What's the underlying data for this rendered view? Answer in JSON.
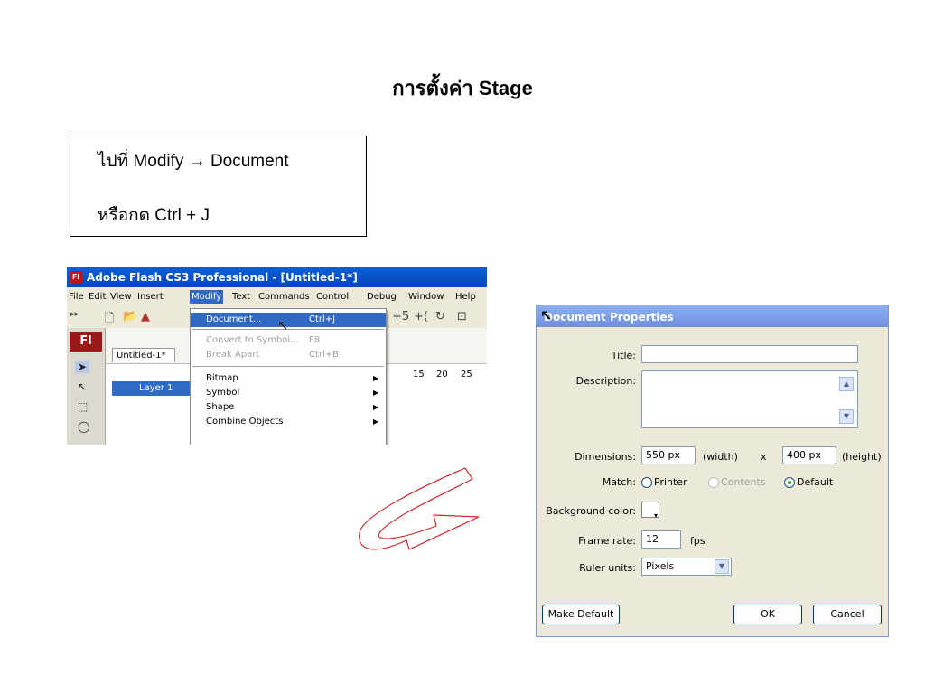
{
  "slide": {
    "title": "การตั้งค่า Stage",
    "instructions": {
      "line1": "ไปที่ Modify → Document",
      "line2": "หรือกด Ctrl + J"
    }
  },
  "flash": {
    "window_title": "Adobe Flash CS3 Professional - [Untitled-1*]",
    "logo": "Fl",
    "menu": [
      "File",
      "Edit",
      "View",
      "Insert",
      "Modify",
      "Text",
      "Commands",
      "Control",
      "Debug",
      "Window",
      "Help"
    ],
    "doc_tab": "Untitled-1*",
    "layer_name": "Layer 1",
    "ruler": [
      "15",
      "20",
      "25"
    ],
    "tools_logo": "Fl",
    "modify_menu": {
      "document": {
        "label": "Document...",
        "shortcut": "Ctrl+J"
      },
      "convert": {
        "label": "Convert to Symbol...",
        "shortcut": "F8"
      },
      "break_apart": {
        "label": "Break Apart",
        "shortcut": "Ctrl+B"
      },
      "bitmap": "Bitmap",
      "symbol": "Symbol",
      "shape": "Shape",
      "combine": "Combine Objects"
    }
  },
  "dialog": {
    "title": "Document Properties",
    "title_label": "Title:",
    "description_label": "Description:",
    "dimensions_label": "Dimensions:",
    "width_value": "550 px",
    "width_text": "(width)",
    "x": "x",
    "height_value": "400 px",
    "height_text": "(height)",
    "match_label": "Match:",
    "match_printer": "Printer",
    "match_contents": "Contents",
    "match_default": "Default",
    "match_selected": "Default",
    "bg_label": "Background color:",
    "frame_rate_label": "Frame rate:",
    "frame_rate_value": "12",
    "fps": "fps",
    "ruler_label": "Ruler units:",
    "ruler_value": "Pixels",
    "make_default": "Make Default",
    "ok": "OK",
    "cancel": "Cancel"
  },
  "colors": {
    "arrow_stroke": "#cc2a2a",
    "titlebar": "#0a5fd8",
    "menu_highlight": "#316ac5"
  }
}
